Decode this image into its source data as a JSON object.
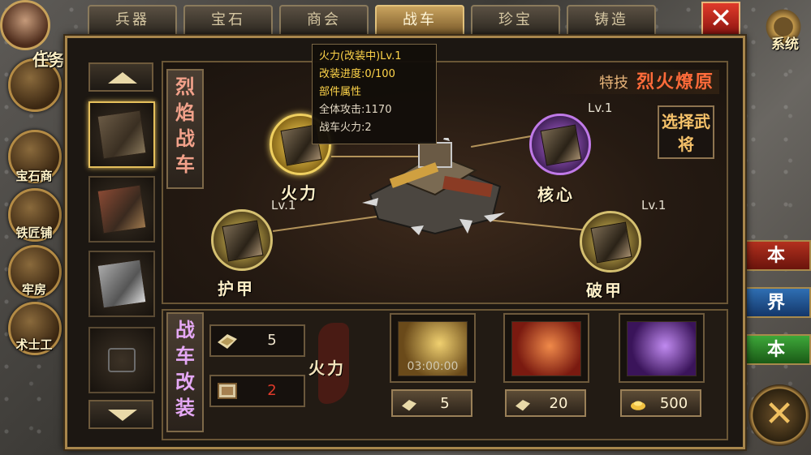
{
  "colors": {
    "accent": "#c49a4c",
    "title_red": "#ff6b3a",
    "tooltip_title": "#ffd54a"
  },
  "player": {
    "level_fragment": "Lv."
  },
  "left_sidebar": [
    {
      "label": "任务",
      "icon": "scroll-icon"
    },
    {
      "label": "宝石商",
      "icon": "gem-merchant-icon"
    },
    {
      "label": "铁匠铺",
      "icon": "blacksmith-icon"
    },
    {
      "label": "牢房",
      "icon": "prison-icon"
    },
    {
      "label": "术士工",
      "icon": "yin-yang-icon"
    }
  ],
  "right_buttons": [
    {
      "label": "本"
    },
    {
      "label": "界"
    },
    {
      "label": "本"
    }
  ],
  "tabs": [
    {
      "label": "兵器",
      "active": false
    },
    {
      "label": "宝石",
      "active": false
    },
    {
      "label": "商会",
      "active": false
    },
    {
      "label": "战车",
      "active": true
    },
    {
      "label": "珍宝",
      "active": false
    },
    {
      "label": "铸造",
      "active": false
    }
  ],
  "system": {
    "label": "系统"
  },
  "vehicle": {
    "name_vertical": "烈焰战车",
    "specialty_label": "特技",
    "specialty_name": "烈火燎原",
    "choose_general": "选择武将",
    "modify_vertical": "战车改装"
  },
  "parts": {
    "firepower": {
      "label": "火力",
      "icon": "cannon-icon",
      "selected": true
    },
    "core": {
      "label": "核心",
      "level": "Lv.1",
      "icon": "core-crate-icon"
    },
    "armor": {
      "label": "护甲",
      "level": "Lv.1",
      "icon": "armor-spikes-icon"
    },
    "break_armor": {
      "label": "破甲",
      "level": "Lv.1",
      "icon": "ram-icon"
    }
  },
  "tooltip": {
    "title": "火力(改装中)Lv.1",
    "progress": "改装进度:0/100",
    "attr_heading": "部件属性",
    "attack": "全体攻击:1170",
    "firepower": "战车火力:2"
  },
  "resources": {
    "material": {
      "value": "5",
      "icon": "material-icon"
    },
    "scroll": {
      "value": "2",
      "icon": "blueprint-icon"
    },
    "current_part_label": "火力"
  },
  "hammers": [
    {
      "timer": "03:00:00",
      "cost": "5",
      "cost_icon": "material-icon"
    },
    {
      "timer": "",
      "cost": "20",
      "cost_icon": "material-icon"
    },
    {
      "timer": "",
      "cost": "500",
      "cost_icon": "gold-ingot-icon"
    }
  ]
}
